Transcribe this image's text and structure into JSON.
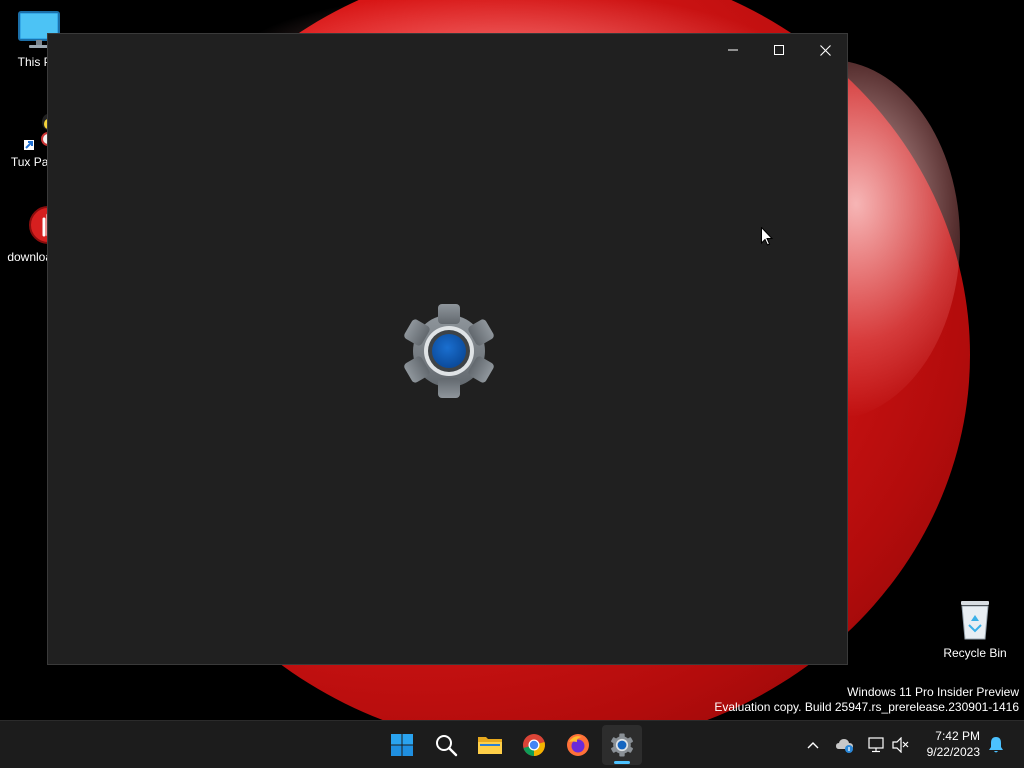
{
  "desktop": {
    "icons": [
      {
        "label": "This PC",
        "icon": "monitor-icon"
      },
      {
        "label": "Tux Paint",
        "icon": "tux-paint-icon"
      },
      {
        "label": "downloads",
        "icon": "stop-hand-icon"
      },
      {
        "label": "Recycle Bin",
        "icon": "recycle-bin-icon"
      }
    ]
  },
  "window": {
    "app": "Settings",
    "splash_icon": "settings-gear-icon",
    "controls": {
      "minimize": "minimize-icon",
      "maximize": "maximize-icon",
      "close": "close-icon"
    }
  },
  "watermark": {
    "line1": "Windows 11 Pro Insider Preview",
    "line2": "Evaluation copy. Build 25947.rs_prerelease.230901-1416"
  },
  "taskbar": {
    "apps": [
      {
        "name": "Start",
        "icon": "windows-start-icon",
        "active": false
      },
      {
        "name": "Search",
        "icon": "search-icon",
        "active": false
      },
      {
        "name": "File Explorer",
        "icon": "folder-icon",
        "active": false
      },
      {
        "name": "Google Chrome",
        "icon": "chrome-icon",
        "active": false
      },
      {
        "name": "Firefox",
        "icon": "firefox-icon",
        "active": false
      },
      {
        "name": "Settings",
        "icon": "settings-gear-icon",
        "active": true
      }
    ],
    "tray": [
      "chevron-up-icon",
      "onedrive-icon",
      "network-icon",
      "volume-muted-icon"
    ],
    "clock": {
      "time": "7:42 PM",
      "date": "9/22/2023"
    },
    "notification_icon": "bell-icon"
  },
  "colors": {
    "accent": "#4cc2ff",
    "window_bg": "#202020",
    "taskbar_bg": "#1c1c1c",
    "wallpaper_red": "#e01818"
  }
}
